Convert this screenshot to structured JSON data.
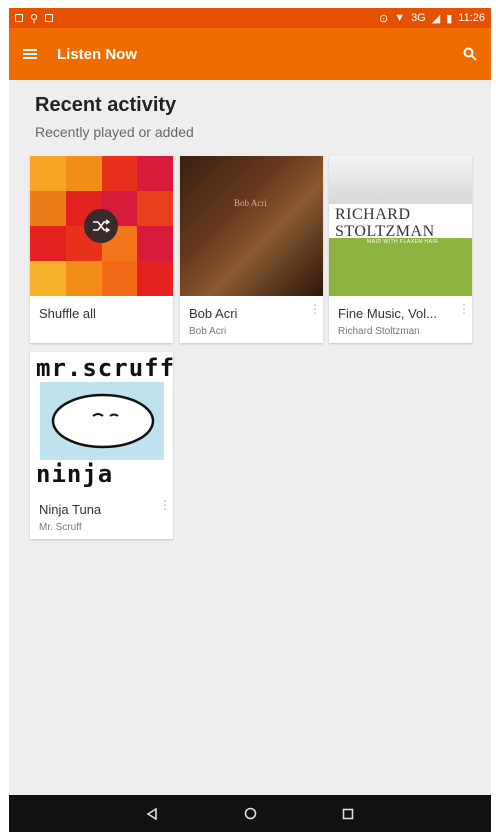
{
  "status_bar": {
    "network": "3G",
    "time": "11:26"
  },
  "app_bar": {
    "title": "Listen Now"
  },
  "section": {
    "title": "Recent activity",
    "subtitle": "Recently played or added"
  },
  "cards": [
    {
      "title": "Shuffle all",
      "subtitle": ""
    },
    {
      "title": "Bob Acri",
      "subtitle": "Bob Acri",
      "art_text": "Bob Acri"
    },
    {
      "title": "Fine Music, Vol...",
      "subtitle": "Richard Stoltzman",
      "art_line1": "RICHARD",
      "art_line2": "STOLTZMAN",
      "art_strip": "MAID WITH FLAXEN HAIR"
    },
    {
      "title": "Ninja Tuna",
      "subtitle": "Mr. Scruff",
      "art_line1": "mr.scruff",
      "art_line2": "ninja tuna"
    }
  ],
  "colors": {
    "status_bar": "#e65100",
    "app_bar": "#ef6c00",
    "background": "#eeeeee",
    "nav_bar": "#111111"
  }
}
